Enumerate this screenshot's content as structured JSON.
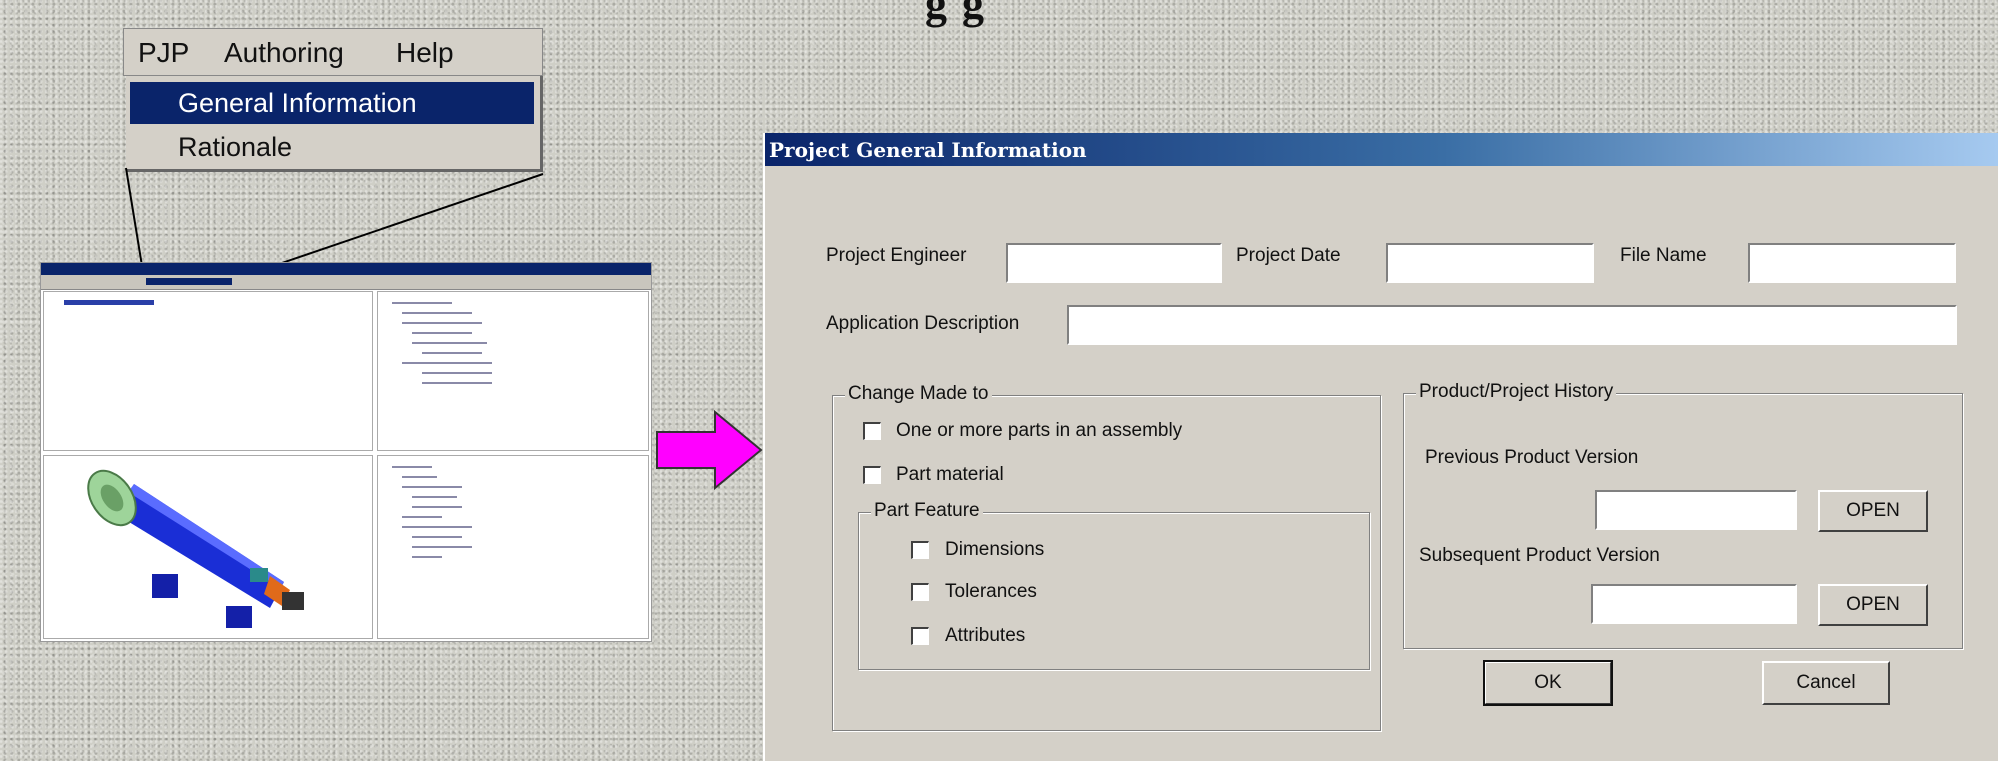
{
  "heading_fragment": "g      g",
  "menu": {
    "bar": [
      "PJP",
      "Authoring",
      "Help"
    ],
    "items": [
      "General Information",
      "Rationale"
    ]
  },
  "dialog": {
    "title": "Project General Information",
    "fields": {
      "project_engineer": {
        "label": "Project Engineer",
        "value": ""
      },
      "project_date": {
        "label": "Project Date",
        "value": ""
      },
      "file_name": {
        "label": "File Name",
        "value": ""
      },
      "application_description": {
        "label": "Application Description",
        "value": ""
      }
    },
    "change_group": {
      "title": "Change Made to",
      "options": [
        {
          "label": "One or more parts in an assembly",
          "checked": false
        },
        {
          "label": "Part material",
          "checked": false
        }
      ],
      "part_feature": {
        "title": "Part Feature",
        "options": [
          {
            "label": "Dimensions",
            "checked": false
          },
          {
            "label": "Tolerances",
            "checked": false
          },
          {
            "label": "Attributes",
            "checked": false
          }
        ]
      }
    },
    "history_group": {
      "title": "Product/Project History",
      "previous_label": "Previous Product Version",
      "subsequent_label": "Subsequent Product Version",
      "previous_value": "",
      "subsequent_value": "",
      "open_label": "OPEN"
    },
    "ok_label": "OK",
    "cancel_label": "Cancel"
  },
  "colors": {
    "arrow": "#ff00ff",
    "selection": "#0a246a",
    "dialog_face": "#d4d0c8",
    "part_body": "#1a2ed6",
    "part_flange": "#9ed49a"
  }
}
